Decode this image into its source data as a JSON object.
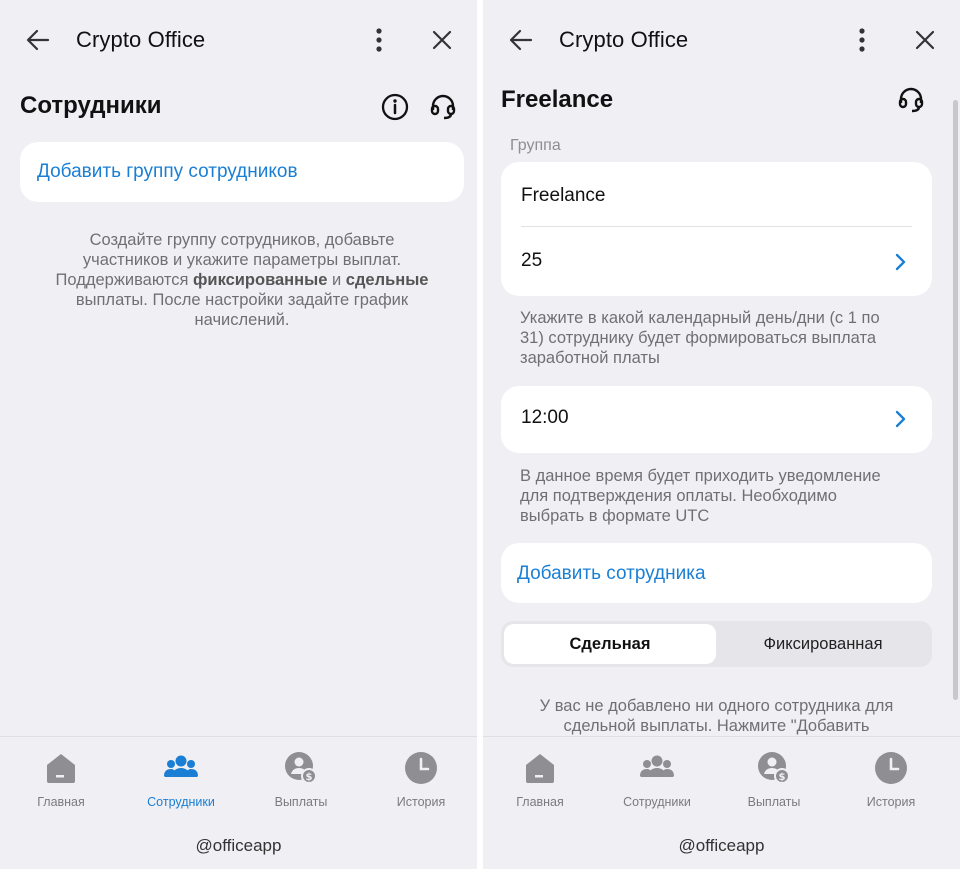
{
  "app": {
    "title": "Crypto Office"
  },
  "left": {
    "page_title": "Сотрудники",
    "add_group_label": "Добавить группу сотрудников",
    "desc": {
      "line1": "Создайте группу сотрудников, добавьте",
      "line2": "участников и укажите параметры выплат.",
      "line3_pre": "Поддерживаются ",
      "line3_bold1": "фиксированные",
      "line3_mid": " и ",
      "line3_bold2": "сдельные",
      "line4": "выплаты. После настройки задайте график",
      "line5": "начислений."
    }
  },
  "right": {
    "page_title": "Freelance",
    "section_label": "Группа",
    "group_name": "Freelance",
    "pay_day": "25",
    "pay_day_hint": {
      "line1": "Укажите в какой календарный день/дни (с 1 по",
      "line2": "31) сотруднику будет формироваться выплата",
      "line3": "заработной платы"
    },
    "time": "12:00",
    "time_hint": {
      "line1": "В данное время будет приходить уведомление",
      "line2": "для подтверждения оплаты. Необходимо",
      "line3": "выбрать в формате UTC"
    },
    "add_employee_label": "Добавить сотрудника",
    "segments": [
      "Сдельная",
      "Фиксированная"
    ],
    "empty_text": {
      "line1": "У вас не добавлено ни одного сотрудника для",
      "line2": "сдельной выплаты. Нажмите \"Добавить"
    }
  },
  "tabs": [
    {
      "label": "Главная",
      "icon": "home-icon"
    },
    {
      "label": "Сотрудники",
      "icon": "employees-icon"
    },
    {
      "label": "Выплаты",
      "icon": "payments-icon"
    },
    {
      "label": "История",
      "icon": "clock-icon"
    }
  ],
  "left_active_tab": "Сотрудники",
  "right_active_tab": "none",
  "handle": "@officeapp",
  "colors": {
    "accent": "#1a7fd4",
    "background": "#efeff4",
    "card": "#ffffff",
    "icon_gray": "#8e8e93"
  }
}
